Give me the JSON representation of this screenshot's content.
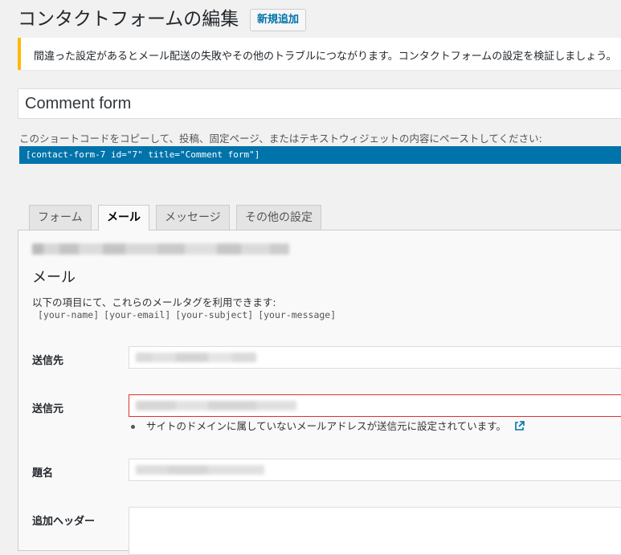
{
  "header": {
    "title": "コンタクトフォームの編集",
    "add_new_label": "新規追加"
  },
  "notice": {
    "text": "間違った設定があるとメール配送の失敗やその他のトラブルにつながります。コンタクトフォームの設定を検証しましょう。"
  },
  "form_title": {
    "value": "Comment form"
  },
  "shortcode": {
    "description": "このショートコードをコピーして、投稿、固定ページ、またはテキストウィジェットの内容にペーストしてください:",
    "code": "[contact-form-7 id=\"7\" title=\"Comment form\"]"
  },
  "tabs": [
    {
      "label": "フォーム",
      "active": false
    },
    {
      "label": "メール",
      "active": true
    },
    {
      "label": "メッセージ",
      "active": false
    },
    {
      "label": "その他の設定",
      "active": false
    }
  ],
  "mail_panel": {
    "section_title": "メール",
    "mailtags_description": "以下の項目にて、これらのメールタグを利用できます:",
    "mailtags": [
      "[your-name]",
      "[your-email]",
      "[your-subject]",
      "[your-message]"
    ],
    "fields": {
      "to_label": "送信先",
      "from_label": "送信元",
      "from_error": "サイトのドメインに属していないメールアドレスが送信元に設定されています。",
      "subject_label": "題名",
      "additional_headers_label": "追加ヘッダー"
    }
  },
  "colors": {
    "accent": "#0073aa",
    "notice_border": "#ffb900",
    "error_border": "#dc3232"
  }
}
